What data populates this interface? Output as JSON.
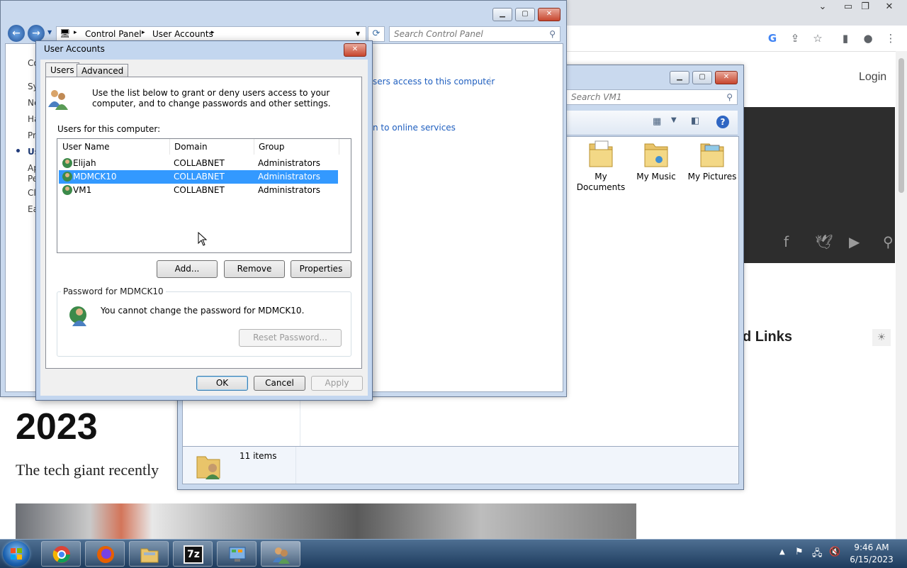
{
  "browser": {
    "login_label": "Login",
    "links_heading_partial": "d Links",
    "year_heading": "2023",
    "article_snippet": "The tech giant recently"
  },
  "control_panel": {
    "breadcrumb": [
      "Control Panel",
      "User Accounts"
    ],
    "search_placeholder": "Search Control Panel",
    "left_items": [
      "Co",
      "Sy",
      "Ne",
      "Ha",
      "Pr",
      "Us",
      "Ap",
      "Pe",
      "Cl",
      "Ea"
    ],
    "links": {
      "access": "sers access to this computer",
      "online": "n to online services"
    }
  },
  "explorer": {
    "search_placeholder": "Search VM1",
    "folders": [
      {
        "line1": "My",
        "line2": "Documents"
      },
      {
        "line1": "My Music",
        "line2": ""
      },
      {
        "line1": "My Pictures",
        "line2": ""
      }
    ],
    "status_items": "11 items"
  },
  "dialog": {
    "title": "User Accounts",
    "tabs": [
      "Users",
      "Advanced"
    ],
    "intro": "Use the list below to grant or deny users access to your computer, and to change passwords and other settings.",
    "users_label": "Users for this computer:",
    "columns": [
      "User Name",
      "Domain",
      "Group"
    ],
    "rows": [
      {
        "name": "Elijah",
        "domain": "COLLABNET",
        "group": "Administrators"
      },
      {
        "name": "MDMCK10",
        "domain": "COLLABNET",
        "group": "Administrators"
      },
      {
        "name": "VM1",
        "domain": "COLLABNET",
        "group": "Administrators"
      }
    ],
    "buttons": {
      "add": "Add...",
      "remove": "Remove",
      "properties": "Properties"
    },
    "password_group": "Password for MDMCK10",
    "password_message": "You cannot change the password for MDMCK10.",
    "reset_password": "Reset Password...",
    "ok": "OK",
    "cancel": "Cancel",
    "apply": "Apply"
  },
  "taskbar": {
    "time": "9:46 AM",
    "date": "6/15/2023"
  },
  "colors": {
    "selection": "#3399ff",
    "link": "#1e5ebf",
    "taskbar": "#1d3b5d"
  }
}
